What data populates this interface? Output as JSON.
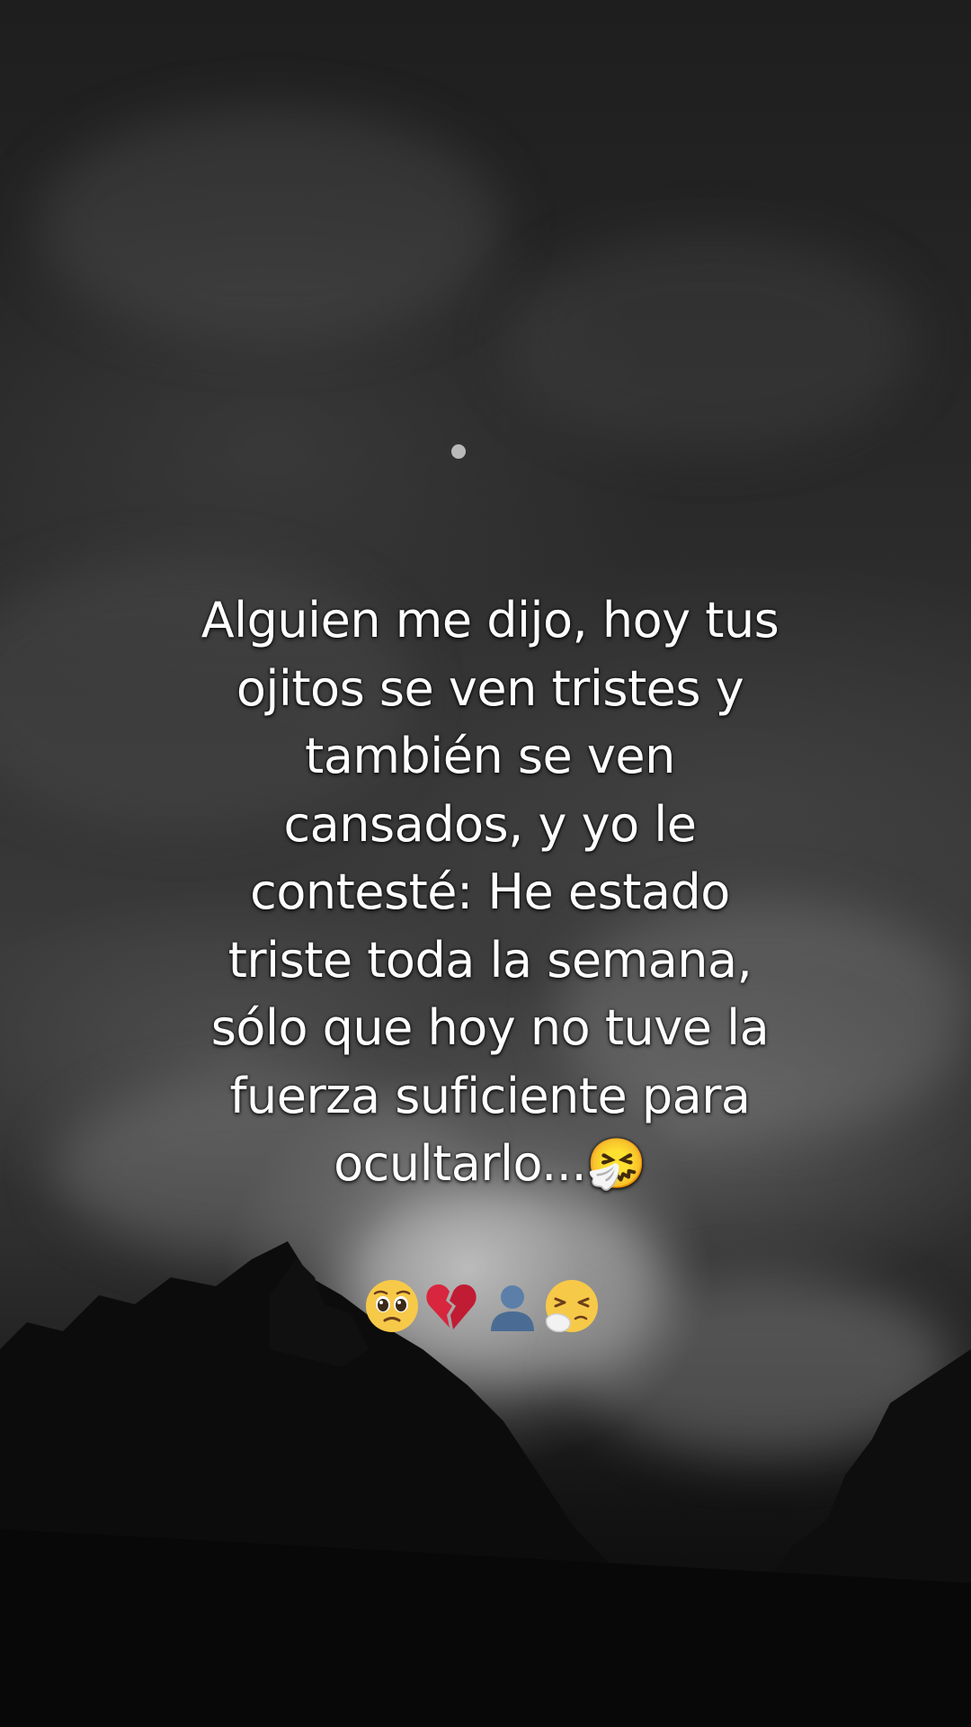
{
  "caption": {
    "line1": "Alguien me dijo, hoy tus",
    "line2": "ojitos se ven tristes y",
    "line3": "también se ven",
    "line4": "cansados, y yo le",
    "line5": "contesté: He estado",
    "line6": "triste toda la semana,",
    "line7": "sólo que hoy no tuve la",
    "line8": "fuerza suficiente para",
    "line9": "ocultarlo...🤧"
  },
  "emoji_row": {
    "pleading": "🥺",
    "broken_heart": "💔",
    "bust_silhouette": "👤",
    "sneezing": "🤧"
  },
  "colors": {
    "text": "#ffffff",
    "sky_dark": "#1e1e1e",
    "sky_light": "#b9b9b9"
  }
}
